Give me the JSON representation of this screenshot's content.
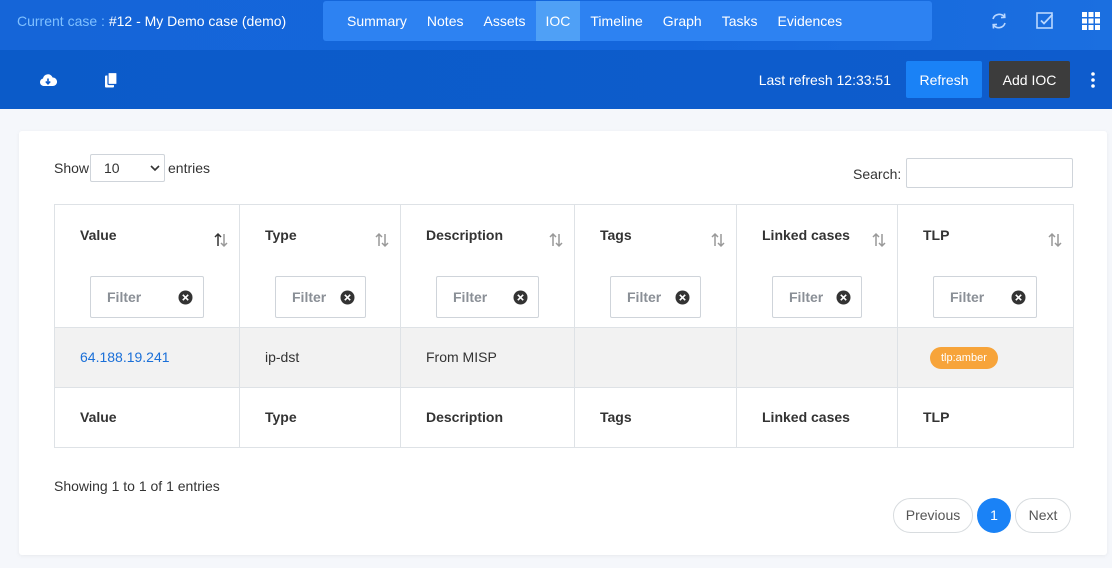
{
  "header": {
    "case_prefix": "Current case :",
    "case_title": "#12 - My Demo case (demo)",
    "nav": [
      "Summary",
      "Notes",
      "Assets",
      "IOC",
      "Timeline",
      "Graph",
      "Tasks",
      "Evidences"
    ],
    "active_nav": "IOC",
    "right_icons": [
      "refresh-cycle-icon",
      "checkbox-icon",
      "apps-grid-icon"
    ]
  },
  "toolbar": {
    "left_icons": [
      "cloud-download-icon",
      "copy-icon"
    ],
    "last_refresh": "Last refresh 12:33:51",
    "refresh_label": "Refresh",
    "add_label": "Add IOC",
    "menu_icon": "kebab-menu-icon"
  },
  "table_controls": {
    "show_label": "Show",
    "page_length": "10",
    "entries_label": "entries",
    "search_label": "Search:",
    "search_value": ""
  },
  "table": {
    "columns": [
      "Value",
      "Type",
      "Description",
      "Tags",
      "Linked cases",
      "TLP"
    ],
    "filter_placeholder": "Filter",
    "rows": [
      {
        "value": "64.188.19.241",
        "type": "ip-dst",
        "description": "From MISP",
        "tags": "",
        "linked_cases": "",
        "tlp": "tlp:amber"
      }
    ]
  },
  "footer": {
    "info": "Showing 1 to 1 of 1 entries",
    "previous_label": "Previous",
    "current_page": "1",
    "next_label": "Next"
  },
  "colors": {
    "header_blue": "#1466dc",
    "nav_pill": "#2d82f2",
    "nav_active": "#4fa0f6",
    "toolbar_blue": "#0d5bcb",
    "primary_button": "#1a82f6",
    "dark_button": "#3c3c3c",
    "tlp_amber": "#f7a43a",
    "link": "#1a6fd8"
  }
}
